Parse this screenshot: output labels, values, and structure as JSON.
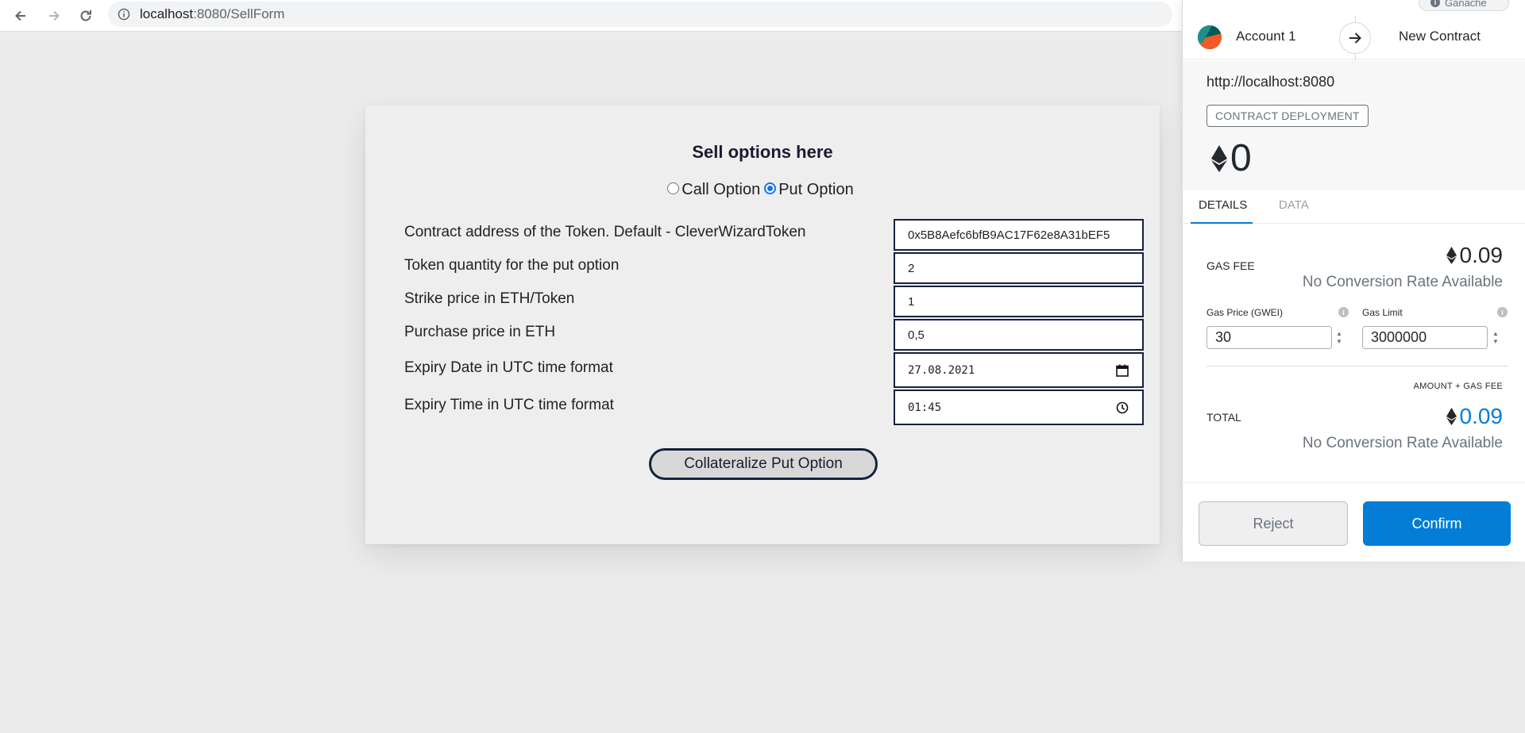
{
  "browser": {
    "url_host": "localhost",
    "url_path": ":8080/SellForm"
  },
  "form": {
    "title": "Sell options here",
    "option_types": [
      {
        "label": "Call Option",
        "selected": false
      },
      {
        "label": "Put Option",
        "selected": true
      }
    ],
    "fields": [
      {
        "label": "Contract address of the Token. Default - CleverWizardToken",
        "value": "0x5B8Aefc6bfB9AC17F62e8A31bEF5"
      },
      {
        "label": "Token quantity for the put option",
        "value": "2"
      },
      {
        "label": "Strike price in ETH/Token",
        "value": "1"
      },
      {
        "label": "Purchase price in ETH",
        "value": "0,5"
      },
      {
        "label": "Expiry Date in UTC time format",
        "value": "27.08.2021"
      },
      {
        "label": "Expiry Time in UTC time format",
        "value": "01:45"
      }
    ],
    "submit_label": "Collateralize Put Option"
  },
  "metamask": {
    "network": "Ganache",
    "account_name": "Account 1",
    "recipient": "New Contract",
    "origin": "http://localhost:8080",
    "badge": "CONTRACT DEPLOYMENT",
    "amount": "0",
    "tabs": [
      "DETAILS",
      "DATA"
    ],
    "gas_fee_label": "GAS FEE",
    "gas_fee": "0.09",
    "no_conversion": "No Conversion Rate Available",
    "gas_price_label": "Gas Price (GWEI)",
    "gas_price": "30",
    "gas_limit_label": "Gas Limit",
    "gas_limit": "3000000",
    "amount_gas_label": "AMOUNT + GAS FEE",
    "total_label": "TOTAL",
    "total": "0.09",
    "reject_label": "Reject",
    "confirm_label": "Confirm"
  },
  "colors": {
    "accent_blue": "#037dd6",
    "form_border": "#16213e",
    "radio_selected": "#1a73e8"
  }
}
